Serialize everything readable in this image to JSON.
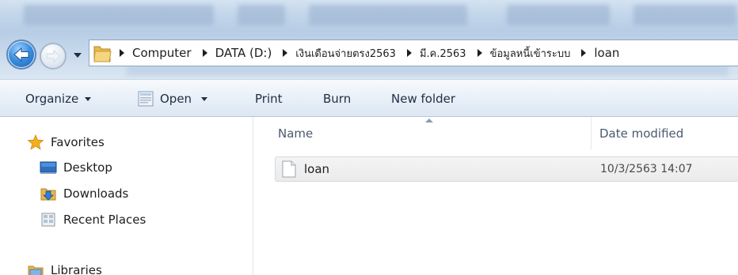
{
  "address_bar": {
    "crumbs": [
      "Computer",
      "DATA (D:)",
      "เงินเดือนจ่ายตรง2563",
      "มี.ค.2563",
      "ข้อมูลหนี้เข้าระบบ",
      "loan"
    ]
  },
  "toolbar": {
    "organize": "Organize",
    "open": "Open",
    "print": "Print",
    "burn": "Burn",
    "new_folder": "New folder"
  },
  "nav_pane": {
    "favorites": "Favorites",
    "desktop": "Desktop",
    "downloads": "Downloads",
    "recent_places": "Recent Places",
    "libraries": "Libraries"
  },
  "content": {
    "columns": {
      "name": "Name",
      "date_modified": "Date modified"
    },
    "files": [
      {
        "name": "loan",
        "date_modified": "10/3/2563 14:07",
        "icon": "document-icon"
      }
    ]
  },
  "icons": {
    "back": "back-arrow-icon",
    "forward": "forward-arrow-icon",
    "folder": "folder-icon",
    "favorites": "star-icon",
    "desktop": "desktop-icon",
    "downloads": "downloads-icon",
    "recent_places": "recent-places-icon",
    "libraries": "libraries-icon"
  },
  "colors": {
    "titlebar": "#c3d6ea",
    "toolbar": "#e9f0f8",
    "back_button": "#3b8fe0",
    "selected_row": "#ebebeb",
    "star": "#f2b01e"
  }
}
